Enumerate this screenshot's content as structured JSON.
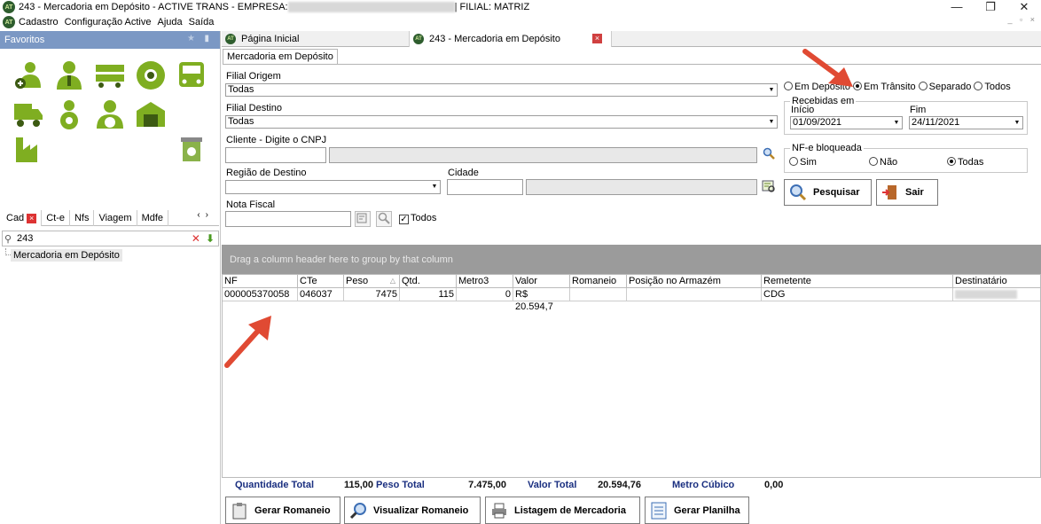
{
  "window": {
    "title_prefix": "243 - Mercadoria em Depósito - ACTIVE TRANS - EMPRESA:",
    "title_suffix": "| FILIAL: MATRIZ",
    "controls": [
      "—",
      "❐",
      "✕"
    ]
  },
  "menu": {
    "items": [
      "Cadastro",
      "Configuração Active",
      "Ajuda",
      "Saída"
    ],
    "mdi_controls": "_ ▫ ×"
  },
  "favorites": {
    "title": "Favoritos",
    "tabs": [
      "Cad",
      "Ct-e",
      "Nfs",
      "Viagem",
      "Mdfe"
    ],
    "search_value": "243",
    "tree_item": "Mercadoria em Depósito"
  },
  "doc_tabs": [
    {
      "label": "Página Inicial"
    },
    {
      "label": "243 - Mercadoria em Depósito"
    }
  ],
  "inner_tab": "Mercadoria em Depósito",
  "form": {
    "filial_origem_label": "Filial Origem",
    "filial_origem_value": "Todas",
    "filial_destino_label": "Filial Destino",
    "filial_destino_value": "Todas",
    "cliente_label": "Cliente - Digite o CNPJ",
    "regiao_label": "Região de Destino",
    "cidade_label": "Cidade",
    "nota_fiscal_label": "Nota Fiscal",
    "todos_label": "Todos",
    "status_options": [
      "Em Depósito",
      "Em Trânsito",
      "Separado",
      "Todos"
    ],
    "status_selected": "Em Trânsito",
    "recebidas_title": "Recebidas em",
    "inicio_label": "Início",
    "inicio_value": "01/09/2021",
    "fim_label": "Fim",
    "fim_value": "24/11/2021",
    "nfe_title": "NF-e bloqueada",
    "nfe_options": [
      "Sim",
      "Não",
      "Todas"
    ],
    "nfe_selected": "Todas",
    "pesquisar_label": "Pesquisar",
    "sair_label": "Sair"
  },
  "grid": {
    "group_hint": "Drag a column header here to group by that column",
    "columns": [
      "NF",
      "CTe",
      "Peso",
      "Qtd.",
      "Metro3",
      "Valor",
      "Romaneio",
      "Posição no Armazém",
      "Remetente",
      "Destinatário"
    ],
    "rows": [
      [
        "000005370058",
        "046037",
        "7475",
        "115",
        "0",
        "R$ 20.594,7",
        "",
        "",
        "CDG",
        ""
      ]
    ]
  },
  "totals": {
    "quantidade_label": "Quantidade Total",
    "quantidade_value": "115,00",
    "peso_label": "Peso Total",
    "peso_value": "7.475,00",
    "valor_label": "Valor Total",
    "valor_value": "20.594,76",
    "metro_label": "Metro Cúbico",
    "metro_value": "0,00"
  },
  "actions": [
    "Gerar Romaneio",
    "Visualizar Romaneio",
    "Listagem de Mercadoria",
    "Gerar Planilha"
  ],
  "colors": {
    "accent_green": "#7fae21",
    "favorites_header": "#7b98c4",
    "totals_label": "#1a2f80",
    "annotation_red": "#e04a33"
  }
}
